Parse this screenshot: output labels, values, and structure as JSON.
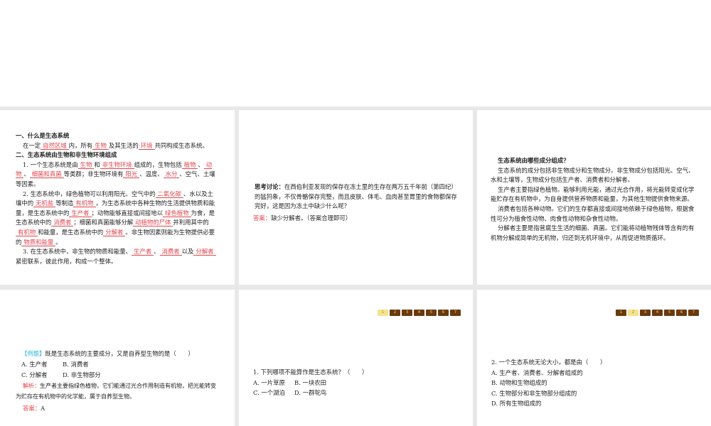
{
  "panel1": {
    "h1": "一、什么是生态系统",
    "h2": "二、生态系统由生物和非生物环境组成",
    "paras": [
      [
        {
          "t": "在一定"
        },
        {
          "t": "自然区域",
          "b": 1
        },
        {
          "t": "内，所有"
        },
        {
          "t": "生物",
          "b": 1
        },
        {
          "t": "及其生活的"
        },
        {
          "t": "环境",
          "b": 1
        },
        {
          "t": "共同构成生态系统。"
        }
      ],
      [
        {
          "t": "1. 一个生态系统是由"
        },
        {
          "t": "生物",
          "b": 1
        },
        {
          "t": "和"
        },
        {
          "t": "非生物环境",
          "b": 1
        },
        {
          "t": "组成的，生物包括"
        },
        {
          "t": "植物",
          "b": 1
        },
        {
          "t": "、"
        },
        {
          "t": "动物",
          "b": 1
        },
        {
          "t": "、"
        },
        {
          "t": "细菌和真菌",
          "b": 1
        },
        {
          "t": "等类群；非生物环境有"
        },
        {
          "t": "阳光",
          "b": 1
        },
        {
          "t": "、温度、"
        },
        {
          "t": "水分",
          "b": 1
        },
        {
          "t": "、空气、土壤等因素。"
        }
      ],
      [
        {
          "t": "2. 生态系统中，绿色植物可以利用阳光、空气中的"
        },
        {
          "t": "二氧化碳",
          "b": 1
        },
        {
          "t": "、水以及土壤中的"
        },
        {
          "t": "无机盐",
          "b": 1
        },
        {
          "t": "等制造"
        },
        {
          "t": "有机物",
          "b": 1
        },
        {
          "t": "，为生态系统中各种生物的生活提供物质和能量，是生态系统中的"
        },
        {
          "t": "生产者",
          "b": 1
        },
        {
          "t": "；动物能够直接或间接地以"
        },
        {
          "t": "绿色植物",
          "b": 1
        },
        {
          "t": "为食，是生态系统中的"
        },
        {
          "t": "消费者",
          "b": 1
        },
        {
          "t": "；细菌和真菌能够分解"
        },
        {
          "t": "动植物的尸体",
          "b": 1
        },
        {
          "t": "并利用其中的"
        },
        {
          "t": "有机物",
          "b": 1
        },
        {
          "t": "和能量，是生态系统中的"
        },
        {
          "t": "分解者",
          "b": 1
        },
        {
          "t": "。非生物因素则能为生物提供必要的"
        },
        {
          "t": "物质和能量",
          "b": 1
        },
        {
          "t": "。"
        }
      ],
      [
        {
          "t": "3. 在生态系统中，非生物的物质和能量、"
        },
        {
          "t": "生产者",
          "b": 1
        },
        {
          "t": "、"
        },
        {
          "t": "消费者",
          "b": 1
        },
        {
          "t": "以及"
        },
        {
          "t": "分解者",
          "b": 1
        },
        {
          "t": "紧密联系，彼此作用，构成一个整体。"
        }
      ]
    ]
  },
  "panel2": {
    "label": "思考讨论：",
    "question": "在西伯利亚发现的保存在冻土里的生存在两万五千年前（第四纪）的猛犸象，不仅骨骼保存完整，而且皮肤、体毛、血肉甚至胃里的食物都保存完好，这是因为冻土中缺少什么呢？",
    "answer_label": "答案：",
    "answer": "缺少分解者。（答案合理即可）"
  },
  "panel3": {
    "title": "生态系统由哪些成分组成？",
    "paras": [
      "生态系统的成分包括非生物成分和生物成分。非生物成分包括阳光、空气、水和土壤等，生物成分包括生产者、消费者和分解者。",
      "生产者主要指绿色植物。能够利用光能，通过光合作用，将光能转变成化学能贮存在有机物中，为自身提供营养物质和能量，为其他生物提供食物来源。",
      "消费者包括各种动物。它们的生存都直接或间接地依赖于绿色植物，根据食性可分为植食性动物、肉食性动物和杂食性动物。",
      "分解者主要是指营腐生生活的细菌、真菌。它们能将动植物残体等含有的有机物分解成简单的无机物，归还到无机环境中，从而促进物质循环。"
    ]
  },
  "panel4": {
    "tag": "【例题】",
    "question": "既是生态系统的主要成分，又是自养型生物的是（　　）",
    "options": [
      "A. 生产者",
      "B. 消费者",
      "C. 分解者",
      "D. 非生物部分"
    ],
    "analysis_label": "解析：",
    "analysis": "生产者主要指绿色植物，它们能通过光合作用制造有机物，把光能转变为贮存在有机物中的化学能，属于自养型生物。",
    "answer_label": "答案：",
    "answer": "A"
  },
  "panel5": {
    "pager": [
      "1",
      "2",
      "3",
      "4",
      "5",
      "6",
      "7"
    ],
    "active": 0,
    "question": "1. 下列哪项不能算作是生态系统？（　　）",
    "options": [
      "A. 一片草原",
      "B. 一块农田",
      "C. 一个湖泊",
      "D. 一群鸵鸟"
    ]
  },
  "panel6": {
    "pager": [
      "1",
      "2",
      "3",
      "4",
      "5",
      "6",
      "7"
    ],
    "active": 1,
    "question": "2. 一个生态系统无论大小，都是由（　　）",
    "options": [
      "A. 生产者、消费者、分解者组成的",
      "B. 动物和生物组成的",
      "C. 生物部分和非生物部分组成的",
      "D. 所有生物组成的"
    ]
  }
}
